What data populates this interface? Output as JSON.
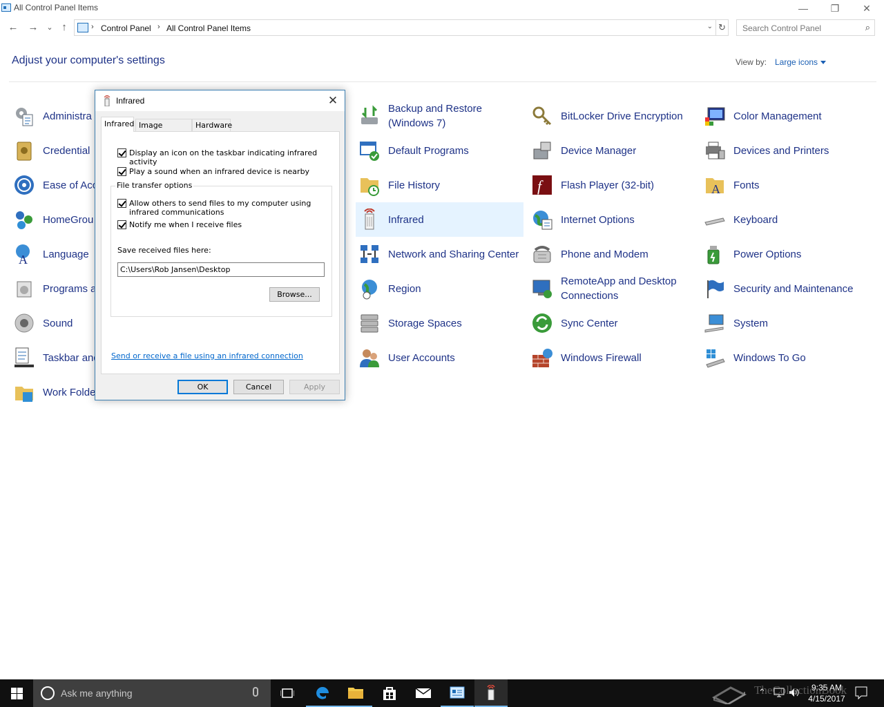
{
  "window": {
    "title": "All Control Panel Items",
    "minimize": "—",
    "maximize": "❐",
    "close": "✕"
  },
  "nav": {
    "back": "←",
    "forward": "→",
    "recent": "⌄",
    "up": "↑",
    "breadcrumb": [
      "Control Panel",
      "All Control Panel Items"
    ],
    "separator": "›",
    "dropdown": "⌄",
    "refresh": "↻",
    "search_placeholder": "Search Control Panel",
    "search_icon": "⌕"
  },
  "header": {
    "title": "Adjust your computer's settings",
    "view_by_label": "View by:",
    "view_by_value": "Large icons"
  },
  "items": {
    "col1": [
      "Administra",
      "Credential",
      "Ease of Acc",
      "HomeGrou",
      "Language",
      "Programs a",
      "Sound",
      "Taskbar and",
      "Work Folde"
    ],
    "col3": [
      "Backup and Restore (Windows 7)",
      "Default Programs",
      "File History",
      "Infrared",
      "Network and Sharing Center",
      "Region",
      "Storage Spaces",
      "User Accounts"
    ],
    "col4": [
      "BitLocker Drive Encryption",
      "Device Manager",
      "Flash Player (32-bit)",
      "Internet Options",
      "Phone and Modem",
      "RemoteApp and Desktop Connections",
      "Sync Center",
      "Windows Firewall"
    ],
    "col5": [
      "Color Management",
      "Devices and Printers",
      "Fonts",
      "Keyboard",
      "Power Options",
      "Security and Maintenance",
      "System",
      "Windows To Go"
    ],
    "selected": "Infrared",
    "accent": "#1e3287",
    "selected_bg": "#e5f3ff"
  },
  "dialog": {
    "title": "Infrared",
    "close": "✕",
    "tabs": [
      "Infrared",
      "Image Transfer",
      "Hardware"
    ],
    "active_tab": "Infrared",
    "checkboxes": {
      "display_icon": "Display an icon on the taskbar indicating infrared activity",
      "play_sound": "Play a sound when an infrared device is nearby",
      "allow_send": "Allow others to send files to my computer using infrared communications",
      "notify": "Notify me when I receive files"
    },
    "group_label": "File transfer options",
    "save_label": "Save received files here:",
    "save_path": "C:\\Users\\Rob Jansen\\Desktop",
    "browse": "Browse...",
    "link": "Send or receive a file using an infrared connection",
    "ok": "OK",
    "cancel": "Cancel",
    "apply": "Apply"
  },
  "taskbar": {
    "search_placeholder": "Ask me anything",
    "time": "9:35 AM",
    "date": "4/15/2017",
    "watermark": "TheCollectionBook"
  }
}
